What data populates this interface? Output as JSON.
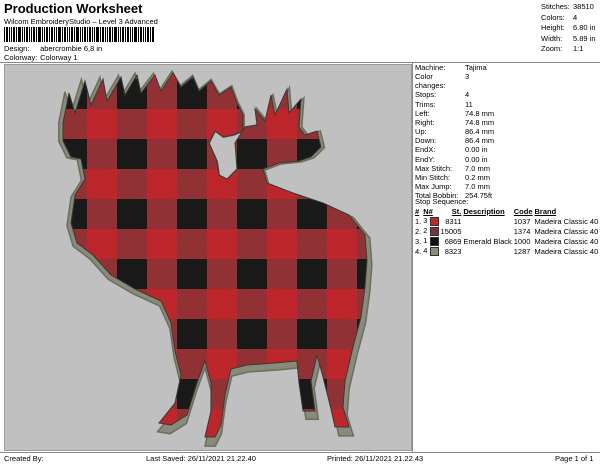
{
  "header": {
    "title": "Production Worksheet",
    "software": "Wilcom EmbroideryStudio – Level 3 Advanced",
    "design_label": "Design:",
    "design_value": "abercrombie 6,8 in",
    "colorway_label": "Colorway:",
    "colorway_value": "Colorway 1"
  },
  "stats": [
    {
      "label": "Stitches:",
      "value": "38510"
    },
    {
      "label": "Colors:",
      "value": "4"
    },
    {
      "label": "Height:",
      "value": "6.80 in"
    },
    {
      "label": "Width:",
      "value": "5.89 in"
    },
    {
      "label": "Zoom:",
      "value": "1:1"
    }
  ],
  "machine_info": [
    {
      "label": "Machine:",
      "value": "Tajima"
    },
    {
      "label": "Color changes:",
      "value": "3"
    },
    {
      "label": "Stops:",
      "value": "4"
    },
    {
      "label": "Trims:",
      "value": "11"
    },
    {
      "label": "Left:",
      "value": "74.8 mm"
    },
    {
      "label": "Right:",
      "value": "74.8 mm"
    },
    {
      "label": "Up:",
      "value": "86.4 mm"
    },
    {
      "label": "Down:",
      "value": "86.4 mm"
    },
    {
      "label": "EndX:",
      "value": "0.00 in"
    },
    {
      "label": "EndY:",
      "value": "0.00 in"
    },
    {
      "label": "Max Stitch:",
      "value": "7.0 mm"
    },
    {
      "label": "Min Stitch:",
      "value": "0.2 mm"
    },
    {
      "label": "Max Jump:",
      "value": "7.0 mm"
    },
    {
      "label": "Total Bobbin:",
      "value": "254.75ft"
    }
  ],
  "stop_sequence": {
    "title": "Stop Sequence:",
    "headers": {
      "num": "#",
      "n": "N#",
      "st": "St.",
      "description": "Description",
      "code": "Code",
      "brand": "Brand"
    },
    "rows": [
      {
        "num": "1.",
        "n": "3",
        "color": "#c0272d",
        "st": "8311",
        "description": "",
        "code": "1037",
        "brand": "Madeira Classic 40"
      },
      {
        "num": "2.",
        "n": "2",
        "color": "#6e3a3e",
        "st": "15005",
        "description": "",
        "code": "1374",
        "brand": "Madeira Classic 40"
      },
      {
        "num": "3.",
        "n": "1",
        "color": "#111111",
        "st": "6869",
        "description": "Emerald Black",
        "code": "1000",
        "brand": "Madeira Classic 40"
      },
      {
        "num": "4.",
        "n": "4",
        "color": "#8a8a7a",
        "st": "8323",
        "description": "",
        "code": "1287",
        "brand": "Madeira Classic 40"
      }
    ]
  },
  "footer": {
    "created_by": "Created By:",
    "last_saved": "Last Saved: 26/11/2021 21.22.40",
    "printed": "Printed: 26/11/2021 21.22.43",
    "page": "Page 1 of 1"
  },
  "colors": {
    "plaid_red": "#c0272d",
    "plaid_maroon": "#6e3a3e",
    "plaid_black": "#1a1a1a",
    "outline": "#8a8a7a",
    "canvas_bg": "#c0c0c0"
  }
}
